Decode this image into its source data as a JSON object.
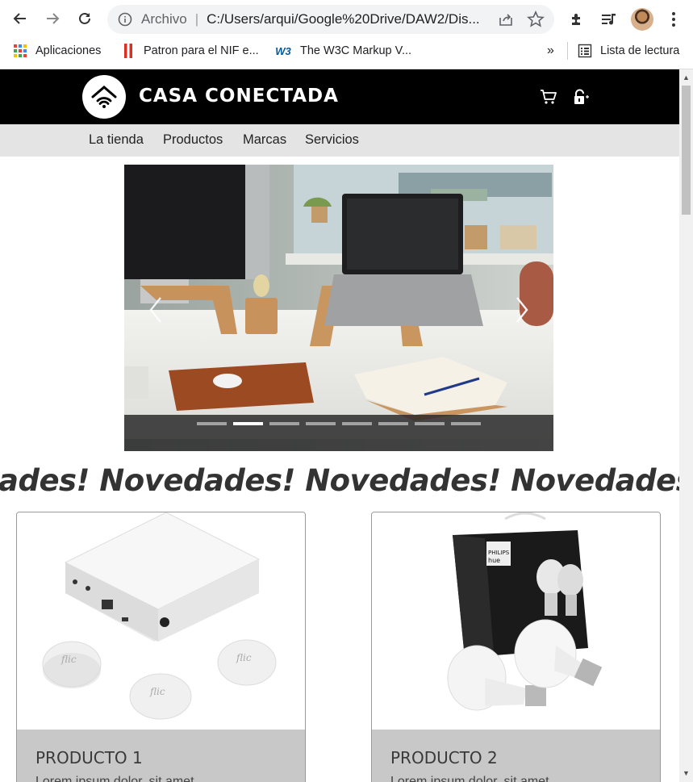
{
  "browser": {
    "address_scheme": "Archivo",
    "address_url": "C:/Users/arqui/Google%20Drive/DAW2/Dis...",
    "bookmarks": [
      {
        "label": "Aplicaciones",
        "icon": "apps-grid-icon"
      },
      {
        "label": "Patron para el NIF e...",
        "icon": "bookmark-red-icon"
      },
      {
        "label": "The W3C Markup V...",
        "icon": "w3c-icon"
      }
    ],
    "overflow": "»",
    "reading_list": "Lista de lectura"
  },
  "site": {
    "brand": "CASA CONECTADA",
    "nav": [
      "La tienda",
      "Productos",
      "Marcas",
      "Servicios"
    ],
    "marquee": "dades! Novedades! Novedades! Novedades! Novedades!",
    "carousel": {
      "slides": 8,
      "active_index": 1
    },
    "products": [
      {
        "title": "PRODUCTO 1",
        "desc": "Lorem ipsum dolor, sit amet"
      },
      {
        "title": "PRODUCTO 2",
        "desc": "Lorem ipsum dolor, sit amet"
      }
    ]
  },
  "colors": {
    "header_bg": "#000000",
    "nav_bg": "#e4e4e4",
    "card_body_bg": "#c8c8c8",
    "marquee_text": "#333333"
  }
}
